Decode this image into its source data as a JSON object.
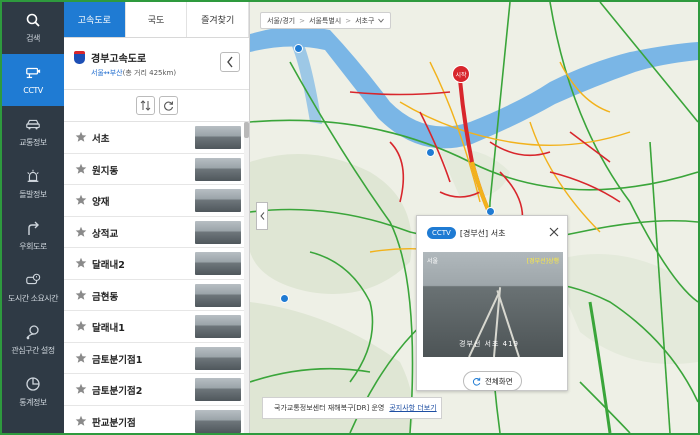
{
  "nav": {
    "items": [
      {
        "label": "검색",
        "icon": "search-icon",
        "active": false
      },
      {
        "label": "CCTV",
        "icon": "cctv-icon",
        "active": true
      },
      {
        "label": "교통정보",
        "icon": "car-icon",
        "active": false
      },
      {
        "label": "돌발정보",
        "icon": "siren-icon",
        "active": false
      },
      {
        "label": "우회도로",
        "icon": "detour-icon",
        "active": false
      },
      {
        "label": "도시간 소요시간",
        "icon": "travel-time-icon",
        "active": false
      },
      {
        "label": "관심구간 설정",
        "icon": "favorite-route-icon",
        "active": false
      },
      {
        "label": "통계정보",
        "icon": "statistics-icon",
        "active": false
      }
    ]
  },
  "tabs": {
    "highway": "고속도로",
    "national": "국도",
    "favorites": "즐겨찾기"
  },
  "route": {
    "badge_number": "1",
    "title": "경부고속도로",
    "from_to": "서울↔부산",
    "length": "(총 거리 425km)"
  },
  "cctv_list": [
    {
      "name": "서초"
    },
    {
      "name": "원지동"
    },
    {
      "name": "양재"
    },
    {
      "name": "상적교"
    },
    {
      "name": "달래내2"
    },
    {
      "name": "금현동"
    },
    {
      "name": "달래내1"
    },
    {
      "name": "금토분기점1"
    },
    {
      "name": "금토분기점2"
    },
    {
      "name": "판교분기점"
    }
  ],
  "map": {
    "breadcrumb": [
      "서울/경기",
      "서울특별시",
      "서초구"
    ],
    "breadcrumb_sep": ">",
    "start_marker": "시작",
    "popup": {
      "badge": "CCTV",
      "route": "[경부선] 서초",
      "image_text": "경부선  서초  419",
      "image_tag_left": "서울",
      "image_tag_right": "[경부선]상행",
      "fullscreen_label": "전체화면"
    },
    "footer_text": "국가교통정보센터 재해복구[DR] 운영",
    "footer_link": "공지사항 더보기"
  },
  "colors": {
    "nav_bg": "#2f3a45",
    "accent": "#1f7bd3",
    "traffic_smooth": "#3aa53a",
    "traffic_slow": "#f2b21b",
    "traffic_congested": "#d8262c",
    "water": "#7ab6e6"
  }
}
